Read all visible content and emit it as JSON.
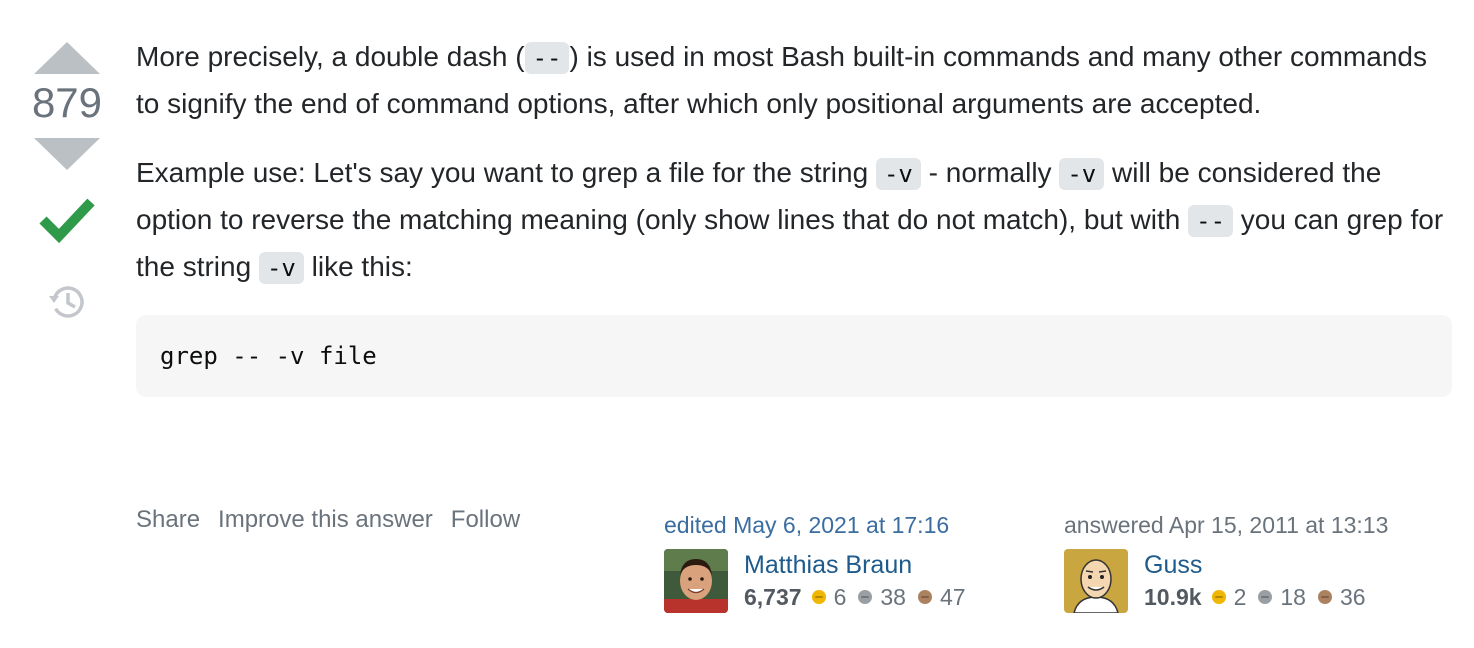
{
  "vote": {
    "count": "879",
    "colors": {
      "arrow": "#bbc0c4",
      "accepted": "#2f9a4a",
      "history": "#c3c7cb"
    }
  },
  "answer": {
    "paragraph1": {
      "before": "More precisely, a double dash (",
      "code": "--",
      "after": ") is used in most Bash built-in commands and many other commands to signify the end of command options, after which only positional arguments are accepted."
    },
    "paragraph2": {
      "text1": "Example use: Let's say you want to grep a file for the string ",
      "code1": "-v",
      "text2": " - normally ",
      "code2": "-v",
      "text3": " will be considered the option to reverse the matching meaning (only show lines that do not match), but with ",
      "code3": "--",
      "text4": " you can grep for the string ",
      "code4": "-v",
      "text5": " like this:"
    },
    "code_block": "grep -- -v file"
  },
  "post_menu": {
    "share": "Share",
    "improve": "Improve this answer",
    "follow": "Follow"
  },
  "editor": {
    "action": "edited",
    "date": "May 6, 2021 at 17:16",
    "name": "Matthias Braun",
    "reputation": "6,737",
    "gold": "6",
    "silver": "38",
    "bronze": "47"
  },
  "author": {
    "action": "answered",
    "date": "Apr 15, 2011 at 13:13",
    "name": "Guss",
    "reputation": "10.9k",
    "gold": "2",
    "silver": "18",
    "bronze": "36"
  },
  "badge_colors": {
    "gold": "#f1b600",
    "silver": "#9a9fa4",
    "bronze": "#ab825f"
  }
}
